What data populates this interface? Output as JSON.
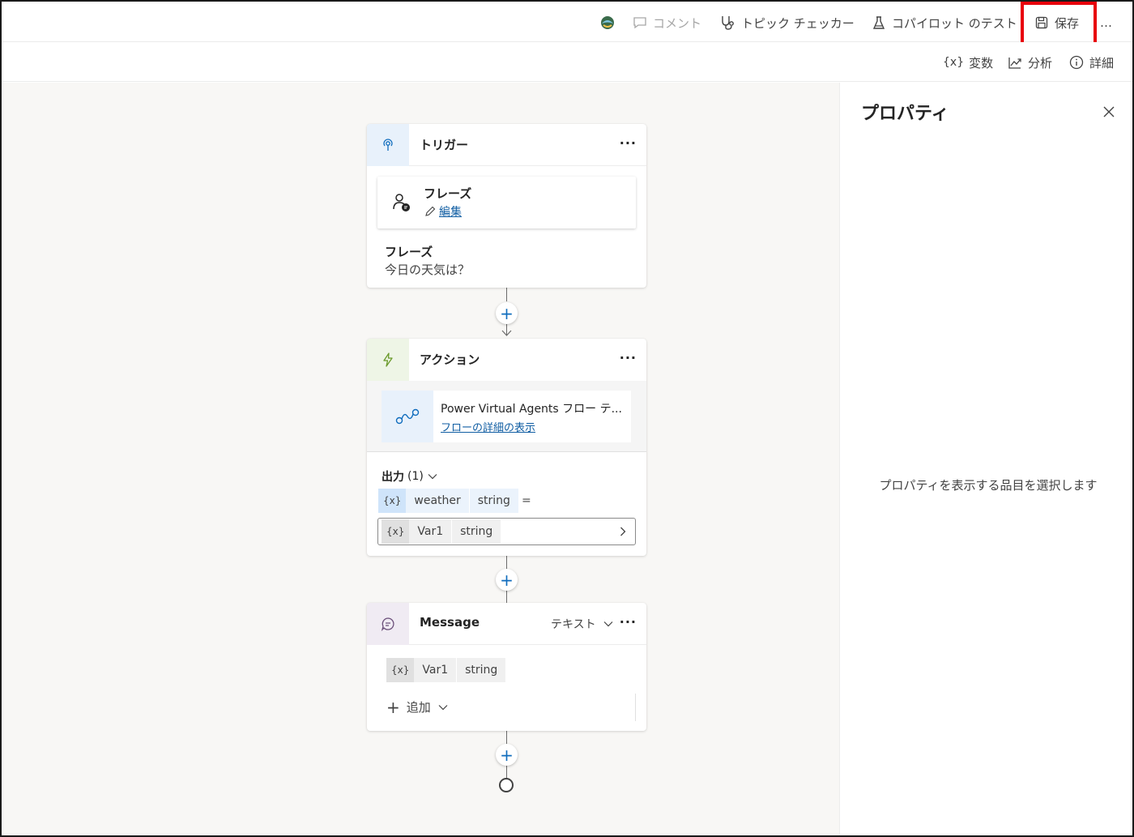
{
  "toolbar": {
    "comment_label": "コメント",
    "topic_checker_label": "トピック チェッカー",
    "test_label": "コパイロット のテスト",
    "save_label": "保存",
    "more_label": "…"
  },
  "subtoolbar": {
    "variables_label": "変数",
    "analytics_label": "分析",
    "details_label": "詳細",
    "variables_icon_text": "{x}"
  },
  "properties_panel": {
    "title": "プロパティ",
    "empty_message": "プロパティを表示する品目を選択します"
  },
  "trigger_card": {
    "title": "トリガー",
    "more": "···",
    "phrase_box_title": "フレーズ",
    "edit_link": "編集",
    "section_label": "フレーズ",
    "phrase_value": "今日の天気は？"
  },
  "action_card": {
    "title": "アクション",
    "more": "···",
    "flow_name": "Power Virtual Agents フロー テ...",
    "flow_link": "フローの詳細の表示",
    "output_label": "出力",
    "output_count": "(1)",
    "output_var": {
      "icon": "{x}",
      "name": "weather",
      "type": "string"
    },
    "equals": "=",
    "assign_var": {
      "icon": "{x}",
      "name": "Var1",
      "type": "string"
    }
  },
  "message_card": {
    "title": "Message",
    "mode_label": "テキスト",
    "more": "···",
    "var": {
      "icon": "{x}",
      "name": "Var1",
      "type": "string"
    },
    "add_label": "追加"
  },
  "colors": {
    "accent": "#0f6cbd",
    "highlight": "#e8000b",
    "trigger_icon_bg": "#e8f1fb",
    "action_icon_bg": "#eef5e6",
    "message_icon_bg": "#f0ebf3"
  }
}
